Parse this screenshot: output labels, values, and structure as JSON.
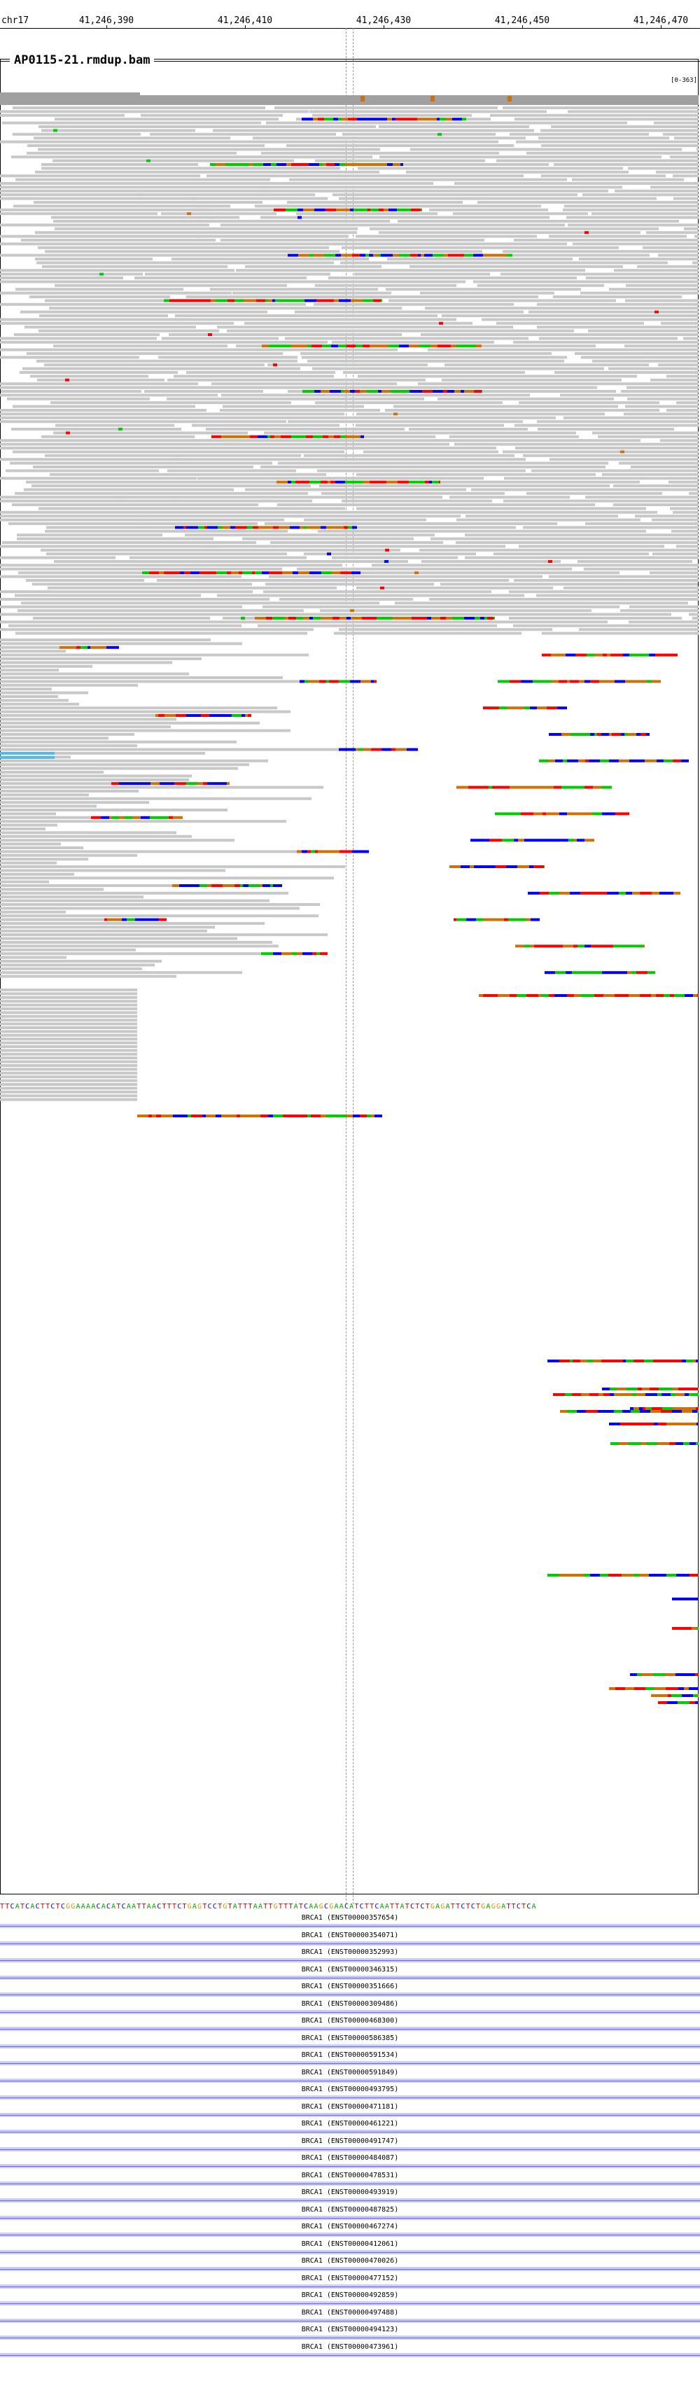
{
  "ruler": {
    "chromosome": "chr17",
    "ticks": [
      {
        "label": "41,246,390"
      },
      {
        "label": "41,246,410"
      },
      {
        "label": "41,246,430"
      },
      {
        "label": "41,246,450"
      },
      {
        "label": "41,246,470"
      }
    ]
  },
  "track": {
    "name": "AP0115-21.rmdup.bam",
    "coverage_range": "[0-363]"
  },
  "colors": {
    "read": "#c8c8c8",
    "base_A": "#00cc00",
    "base_C": "#0000ff",
    "base_G": "#d17105",
    "base_T": "#ff0000",
    "insert": "#5bb8e0",
    "gene": "#ccccff"
  },
  "reference_sequence": "TTCATCACTTCTCGGAAAACACATCAATTAACTTTCTGAGTCCTGTATTTAATTGTTTATCAAGCGAACATCTTCAATTATCTCTGAGATTCTCTGAGGATTCTCA",
  "genes": [
    {
      "label": "BRCA1 (ENST00000357654)"
    },
    {
      "label": "BRCA1 (ENST00000354071)"
    },
    {
      "label": "BRCA1 (ENST00000352993)"
    },
    {
      "label": "BRCA1 (ENST00000346315)"
    },
    {
      "label": "BRCA1 (ENST00000351666)"
    },
    {
      "label": "BRCA1 (ENST00000309486)"
    },
    {
      "label": "BRCA1 (ENST00000468300)"
    },
    {
      "label": "BRCA1 (ENST00000586385)"
    },
    {
      "label": "BRCA1 (ENST00000591534)"
    },
    {
      "label": "BRCA1 (ENST00000591849)"
    },
    {
      "label": "BRCA1 (ENST00000493795)"
    },
    {
      "label": "BRCA1 (ENST00000471181)"
    },
    {
      "label": "BRCA1 (ENST00000461221)"
    },
    {
      "label": "BRCA1 (ENST00000491747)"
    },
    {
      "label": "BRCA1 (ENST00000484087)"
    },
    {
      "label": "BRCA1 (ENST00000478531)"
    },
    {
      "label": "BRCA1 (ENST00000493919)"
    },
    {
      "label": "BRCA1 (ENST00000487825)"
    },
    {
      "label": "BRCA1 (ENST00000467274)"
    },
    {
      "label": "BRCA1 (ENST00000412061)"
    },
    {
      "label": "BRCA1 (ENST00000470026)"
    },
    {
      "label": "BRCA1 (ENST00000477152)"
    },
    {
      "label": "BRCA1 (ENST00000492859)"
    },
    {
      "label": "BRCA1 (ENST00000497488)"
    },
    {
      "label": "BRCA1 (ENST00000494123)"
    },
    {
      "label": "BRCA1 (ENST00000473961)"
    }
  ]
}
